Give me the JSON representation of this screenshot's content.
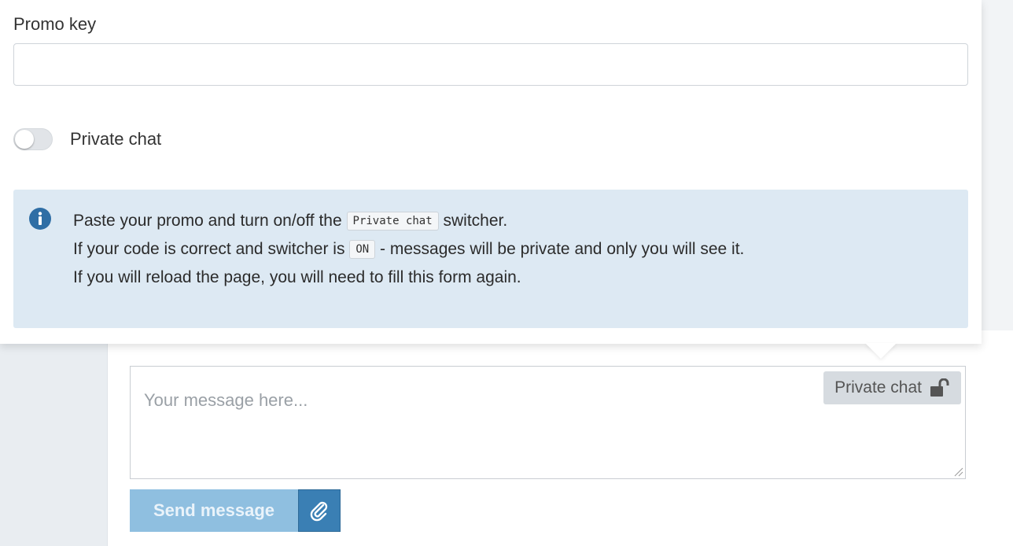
{
  "promo": {
    "label": "Promo key",
    "value": "",
    "placeholder": ""
  },
  "private_toggle": {
    "label": "Private chat",
    "state": "off"
  },
  "info": {
    "line1_pre": "Paste your promo and turn on/off the",
    "line1_code": "Private chat",
    "line1_post": "switcher.",
    "line2_pre": "If your code is correct and switcher is",
    "line2_code": "ON",
    "line2_post": "- messages will be private and only you will see it.",
    "line3": "If you will reload the page, you will need to fill this form again.",
    "icon": "info-circle-icon"
  },
  "composer": {
    "placeholder": "Your message here...",
    "private_badge": "Private chat",
    "private_badge_icon": "unlock-icon",
    "send_label": "Send message",
    "attach_icon": "paperclip-icon"
  },
  "colors": {
    "info_bg": "#dde9f3",
    "info_icon": "#2f6ea5",
    "send_bg": "#8fbfe0",
    "attach_bg": "#3a7fb4"
  }
}
